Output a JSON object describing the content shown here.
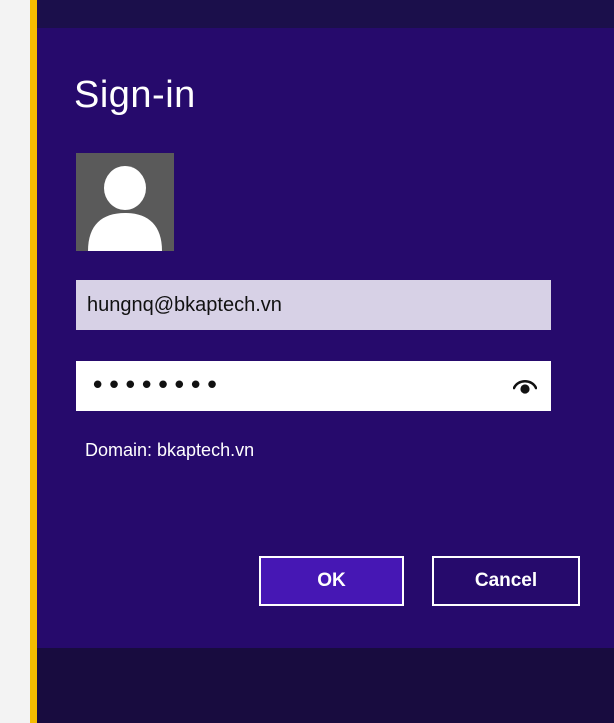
{
  "dialog": {
    "title": "Sign-in",
    "username_value": "hungnq@bkaptech.vn",
    "password_mask": "••••••••",
    "domain_text": "Domain: bkaptech.vn",
    "ok_label": "OK",
    "cancel_label": "Cancel",
    "avatar_icon": "user-silhouette-icon",
    "reveal_icon": "eye-icon"
  },
  "colors": {
    "dialog_bg": "#260a6c",
    "accent_bar": "#f5bc00",
    "ok_button": "#4617b4",
    "username_field": "#d7d1e6"
  }
}
